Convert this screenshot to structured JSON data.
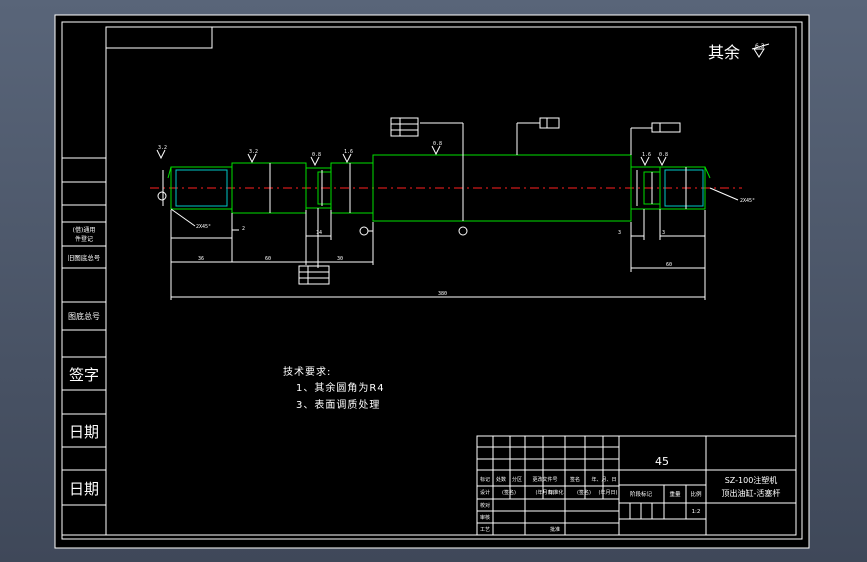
{
  "roughness": {
    "main_text": "其余",
    "main_value": "6.3"
  },
  "side_labels": {
    "borrow": "(借)通用\n件登记",
    "old_drawing": "旧图底总号",
    "base_number": "图底总号",
    "signature": "签字",
    "date1": "日期",
    "date2": "日期"
  },
  "tech_requirements": {
    "title": "技术要求:",
    "item1": "1、其余圆角为R4",
    "item2": "3、表面调质处理"
  },
  "title_block": {
    "material": "45",
    "drawing_title_line1": "SZ-100注塑机",
    "drawing_title_line2": "顶出油缸-活塞杆",
    "scale": "1:2",
    "stage_mark_label": "阶段标记",
    "weight_label": "重量",
    "scale_label": "比例",
    "header_cells": [
      "标记",
      "处数",
      "分区",
      "更改文件号",
      "签名",
      "年、月、日"
    ],
    "row2_cells": [
      "设计",
      "(签名)",
      "(年月日)",
      "标准化",
      "(签名)",
      "(年月日)"
    ],
    "row3_label": "校对",
    "row4_label": "审核",
    "row5_label": "工艺",
    "row5_approve": "批准"
  },
  "annotations": {
    "chamfer_left": "2X45°",
    "chamfer_right": "2X45°",
    "overall_length": "380",
    "dim_36": "36",
    "dim_60": "60",
    "dim_14": "14",
    "dim_30": "30",
    "dim_3a": "3",
    "dim_3b": "3",
    "dim_2": "2",
    "dim_60b": "60",
    "roughness_values": [
      "3.2",
      "3.2",
      "0.8",
      "1.6",
      "0.8",
      "1.6",
      "0.8"
    ]
  }
}
